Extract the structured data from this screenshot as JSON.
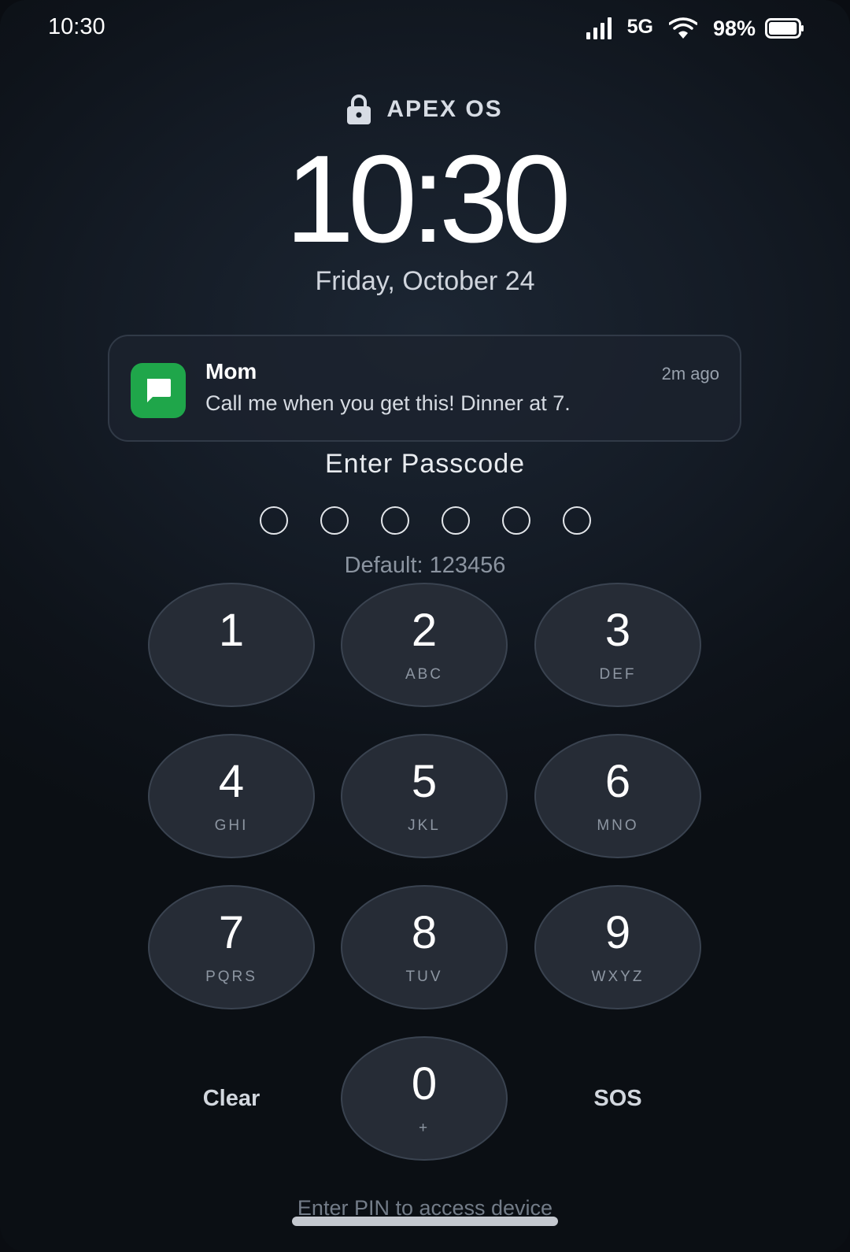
{
  "status_bar": {
    "time": "10:30",
    "network": "5G",
    "battery": "98%",
    "battery_level": 0.98,
    "icons": [
      "signal-icon",
      "wifi-icon",
      "battery-icon"
    ]
  },
  "header": {
    "brand": "APEX OS",
    "brand_icon": "lock-icon",
    "clock": "10:30",
    "date": "Friday, October 24"
  },
  "notification": {
    "app_icon": "chat-icon",
    "app_color": "#1fa64a",
    "sender": "Mom",
    "time": "2m ago",
    "message": "Call me when you get this! Dinner at 7."
  },
  "passcode": {
    "title": "Enter Passcode",
    "length": 6,
    "entered": 0,
    "hint": "Default: 123456"
  },
  "keypad": {
    "keys": [
      {
        "digit": "1",
        "letters": ""
      },
      {
        "digit": "2",
        "letters": "ABC"
      },
      {
        "digit": "3",
        "letters": "DEF"
      },
      {
        "digit": "4",
        "letters": "GHI"
      },
      {
        "digit": "5",
        "letters": "JKL"
      },
      {
        "digit": "6",
        "letters": "MNO"
      },
      {
        "digit": "7",
        "letters": "PQRS"
      },
      {
        "digit": "8",
        "letters": "TUV"
      },
      {
        "digit": "9",
        "letters": "WXYZ"
      },
      {
        "digit": "0",
        "letters": "+"
      }
    ],
    "clear_label": "Clear",
    "sos_label": "SOS"
  },
  "footer": {
    "hint": "Enter PIN to access device"
  }
}
